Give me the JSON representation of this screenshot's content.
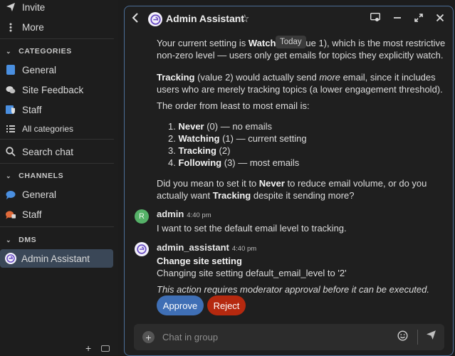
{
  "sidebar": {
    "top_items": [
      {
        "label": "Invite",
        "icon": "send-icon"
      },
      {
        "label": "More",
        "icon": "more-vertical-icon"
      }
    ],
    "categories_header": "CATEGORIES",
    "categories": [
      {
        "label": "General",
        "icon": "category-square-icon",
        "color": "#4a8fe0"
      },
      {
        "label": "Site Feedback",
        "icon": "feedback-bubbles-icon",
        "color": "#cfcfcf"
      },
      {
        "label": "Staff",
        "icon": "staff-shield-icon",
        "color": "#4a8fe0"
      },
      {
        "label": "All categories",
        "icon": "list-icon"
      }
    ],
    "search_chat": "Search chat",
    "channels_header": "CHANNELS",
    "channels": [
      {
        "label": "General",
        "icon": "chat-bubble-icon",
        "color": "#4a8fe0"
      },
      {
        "label": "Staff",
        "icon": "chat-bubble-lock-icon",
        "color": "#e06a3a"
      }
    ],
    "dms_header": "DMS",
    "dms": [
      {
        "label": "Admin Assistant",
        "icon": "assistant-avatar",
        "active": true
      }
    ]
  },
  "header": {
    "title": "Admin Assistant",
    "icons": [
      "threads-icon",
      "minimize-icon",
      "expand-icon",
      "close-icon"
    ]
  },
  "messages": {
    "today_label": "Today",
    "p1_a": "Your current setting is ",
    "p1_b": "Watch",
    "p1_c": "ue 1), which is the most restrictive",
    "p1_line2": "non-zero level — users only get emails for topics they explicitly watch.",
    "p2_bold": "Tracking",
    "p2_a": " (value 2) would actually send ",
    "p2_em": "more",
    "p2_b": " email, since it includes",
    "p2_line2": "users who are merely tracking topics (a lower engagement threshold).",
    "p3": "The order from least to most email is:",
    "list": [
      {
        "num": "1. ",
        "bold": "Never",
        "rest": " (0) — no emails"
      },
      {
        "num": "2. ",
        "bold": "Watching",
        "rest": " (1) — current setting"
      },
      {
        "num": "3. ",
        "bold": "Tracking",
        "rest": " (2)"
      },
      {
        "num": "4. ",
        "bold": "Following",
        "rest": " (3) — most emails"
      }
    ],
    "p4_a": "Did you mean to set it to ",
    "p4_bold1": "Never",
    "p4_b": " to reduce email volume, or do you",
    "p4_c": "actually want ",
    "p4_bold2": "Tracking",
    "p4_d": " despite it sending more?",
    "admin_avatar_letter": "R",
    "admin_name": "admin",
    "admin_time": "4:40 pm",
    "admin_text": "I want to set the default email level to tracking.",
    "assistant_name": "admin_assistant",
    "assistant_time": "4:40 pm",
    "change_title": "Change site setting",
    "change_text": "Changing site setting default_email_level to '2'",
    "approval_note": "This action requires moderator approval before it can be executed.",
    "approve_label": "Approve",
    "reject_label": "Reject"
  },
  "composer": {
    "placeholder": "Chat in group"
  },
  "colors": {
    "accent": "#4a8fe0",
    "approve": "#3f6fb5",
    "reject": "#b5290f",
    "admin_avatar": "#55b168",
    "panel_border": "#4b6e97"
  }
}
